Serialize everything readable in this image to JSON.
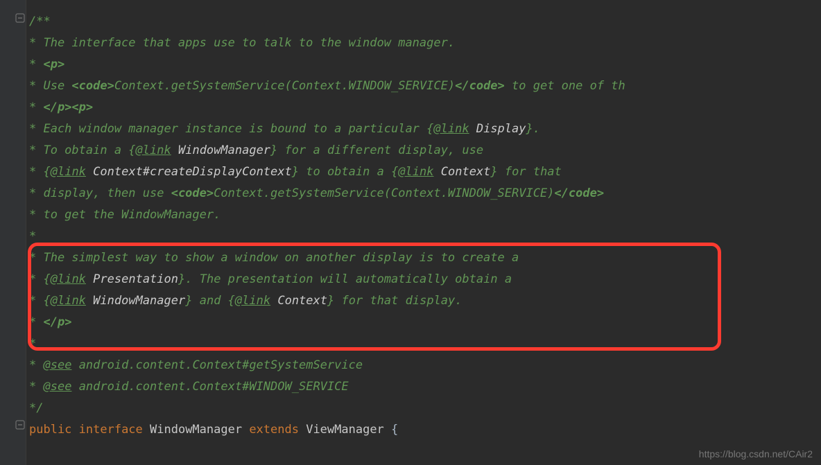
{
  "javadoc": {
    "open": "/**",
    "l1_a": " * The interface that apps use to talk to the window manager.",
    "l2_a": " * ",
    "l2_b": "<p>",
    "l3_a": " * Use ",
    "l3_b": "<code>",
    "l3_c": "Context.getSystemService(Context.WINDOW_SERVICE)",
    "l3_d": "</code>",
    "l3_e": " to get one of th",
    "l4_a": " * ",
    "l4_b": "</p><p>",
    "l5_a": " * Each window manager instance is bound to a particular ",
    "l5_b": "{",
    "l5_c": "@link",
    "l5_d": " ",
    "l5_e": "Display",
    "l5_f": "}",
    "l5_g": ".",
    "l6_a": " * To obtain a ",
    "l6_b": "{",
    "l6_c": "@link",
    "l6_d": " ",
    "l6_e": "WindowManager",
    "l6_f": "}",
    "l6_g": " for a different display, use",
    "l7_a": " * ",
    "l7_b": "{",
    "l7_c": "@link",
    "l7_d": " ",
    "l7_e": "Context#createDisplayContext",
    "l7_f": "}",
    "l7_g": " to obtain a ",
    "l7_h": "{",
    "l7_i": "@link",
    "l7_j": " ",
    "l7_k": "Context",
    "l7_l": "}",
    "l7_m": " for that",
    "l8_a": " * display, then use ",
    "l8_b": "<code>",
    "l8_c": "Context.getSystemService(Context.WINDOW_SERVICE)",
    "l8_d": "</code>",
    "l9_a": " * to get the WindowManager.",
    "l10_a": " * ",
    "l11_a": " * The simplest way to show a window on another display is to create a",
    "l12_a": " * ",
    "l12_b": "{",
    "l12_c": "@link",
    "l12_d": " ",
    "l12_e": "Presentation",
    "l12_f": "}",
    "l12_g": ".  The presentation will automatically obtain a",
    "l13_a": " * ",
    "l13_b": "{",
    "l13_c": "@link",
    "l13_d": " ",
    "l13_e": "WindowManager",
    "l13_f": "}",
    "l13_g": " and ",
    "l13_h": "{",
    "l13_i": "@link",
    "l13_j": " ",
    "l13_k": "Context",
    "l13_l": "}",
    "l13_m": " for that display.",
    "l14_a": " * ",
    "l14_b": "</p>",
    "l15_a": " *",
    "l16_a": " * ",
    "l16_b": "@see",
    "l16_c": " ",
    "l16_d": "android.content.Context#getSystemService",
    "l17_a": " * ",
    "l17_b": "@see",
    "l17_c": " ",
    "l17_d": "android.content.Context#WINDOW_SERVICE",
    "close": " */"
  },
  "code": {
    "kw_public": "public ",
    "kw_interface": "interface ",
    "class_name": "WindowManager ",
    "kw_extends": "extends ",
    "super_name": "ViewManager ",
    "brace": "{"
  },
  "watermark": "https://blog.csdn.net/CAir2"
}
